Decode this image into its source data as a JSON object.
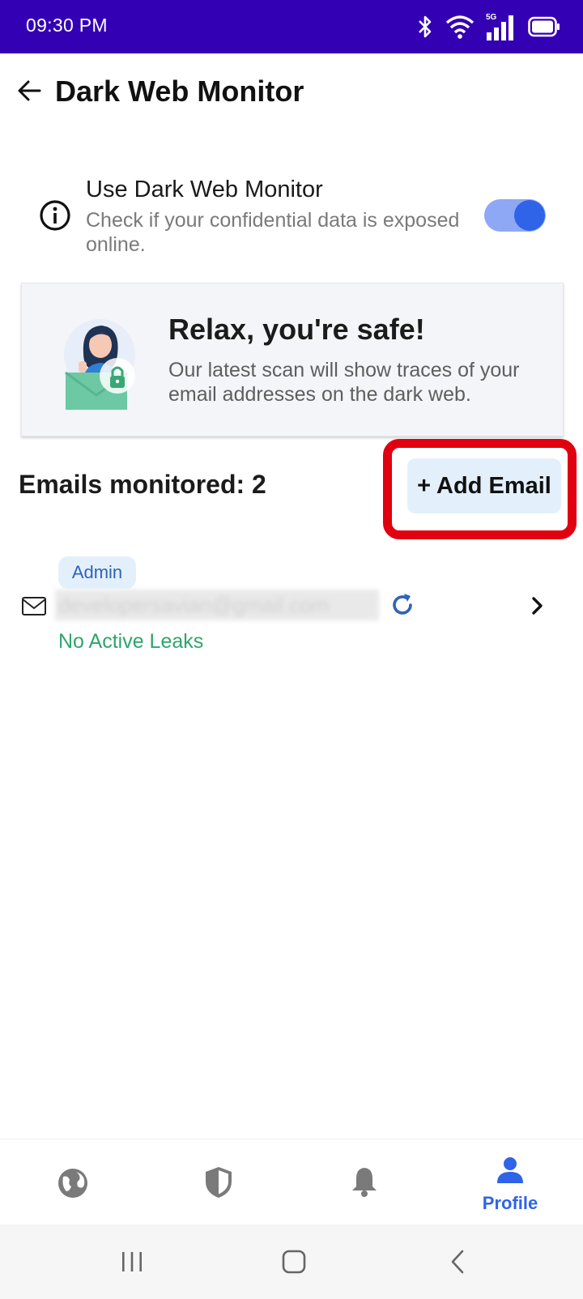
{
  "status_bar": {
    "time": "09:30 PM",
    "network_label": "5G",
    "icons": [
      "bluetooth-icon",
      "wifi-icon",
      "signal-5g-icon",
      "battery-icon"
    ]
  },
  "header": {
    "title": "Dark Web Monitor",
    "back_icon": "arrow-left-icon"
  },
  "monitor_toggle": {
    "title": "Use Dark Web Monitor",
    "description": "Check if your confidential data is exposed online.",
    "enabled": true,
    "icon": "info-icon"
  },
  "status_card": {
    "title": "Relax, you're safe!",
    "description": "Our latest scan will show traces of your email addresses on the dark web.",
    "illustration": "person-with-lock-illustration"
  },
  "emails": {
    "count_label": "Emails monitored: 2",
    "add_button_label": "+ Add Email",
    "items": [
      {
        "role": "Admin",
        "address": "developersavian@gmail.com",
        "status": "No Active Leaks"
      }
    ]
  },
  "bottom_nav": {
    "items": [
      {
        "icon": "globe-icon",
        "label": ""
      },
      {
        "icon": "shield-icon",
        "label": ""
      },
      {
        "icon": "bell-icon",
        "label": ""
      },
      {
        "icon": "profile-icon",
        "label": "Profile",
        "active": true
      }
    ]
  },
  "colors": {
    "status_bar": "#3400b3",
    "accent": "#2f63e8",
    "success": "#2ea56a",
    "highlight": "#e0000f",
    "button_bg": "#e3f0fc"
  }
}
